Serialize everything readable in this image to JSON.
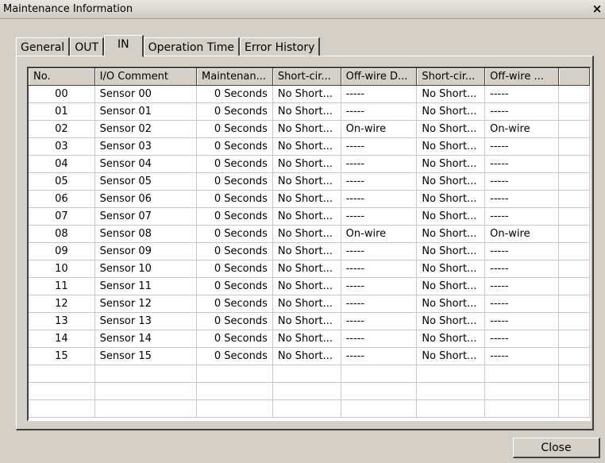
{
  "window": {
    "title": "Maintenance Information",
    "close_glyph": "×"
  },
  "tabs": [
    {
      "label": "General"
    },
    {
      "label": "OUT"
    },
    {
      "label": "IN",
      "active": true
    },
    {
      "label": "Operation Time"
    },
    {
      "label": "Error History"
    }
  ],
  "table": {
    "columns": [
      "No.",
      "I/O Comment",
      "Maintenan...",
      "Short-cir...",
      "Off-wire D...",
      "Short-cir...",
      "Off-wire ...",
      ""
    ],
    "rows": [
      [
        "00",
        "Sensor 00",
        "0 Seconds",
        "No Short...",
        "-----",
        "No Short...",
        "-----"
      ],
      [
        "01",
        "Sensor 01",
        "0 Seconds",
        "No Short...",
        "-----",
        "No Short...",
        "-----"
      ],
      [
        "02",
        "Sensor 02",
        "0 Seconds",
        "No Short...",
        "On-wire",
        "No Short...",
        "On-wire"
      ],
      [
        "03",
        "Sensor 03",
        "0 Seconds",
        "No Short...",
        "-----",
        "No Short...",
        "-----"
      ],
      [
        "04",
        "Sensor 04",
        "0 Seconds",
        "No Short...",
        "-----",
        "No Short...",
        "-----"
      ],
      [
        "05",
        "Sensor 05",
        "0 Seconds",
        "No Short...",
        "-----",
        "No Short...",
        "-----"
      ],
      [
        "06",
        "Sensor 06",
        "0 Seconds",
        "No Short...",
        "-----",
        "No Short...",
        "-----"
      ],
      [
        "07",
        "Sensor 07",
        "0 Seconds",
        "No Short...",
        "-----",
        "No Short...",
        "-----"
      ],
      [
        "08",
        "Sensor 08",
        "0 Seconds",
        "No Short...",
        "On-wire",
        "No Short...",
        "On-wire"
      ],
      [
        "09",
        "Sensor 09",
        "0 Seconds",
        "No Short...",
        "-----",
        "No Short...",
        "-----"
      ],
      [
        "10",
        "Sensor 10",
        "0 Seconds",
        "No Short...",
        "-----",
        "No Short...",
        "-----"
      ],
      [
        "11",
        "Sensor 11",
        "0 Seconds",
        "No Short...",
        "-----",
        "No Short...",
        "-----"
      ],
      [
        "12",
        "Sensor 12",
        "0 Seconds",
        "No Short...",
        "-----",
        "No Short...",
        "-----"
      ],
      [
        "13",
        "Sensor 13",
        "0 Seconds",
        "No Short...",
        "-----",
        "No Short...",
        "-----"
      ],
      [
        "14",
        "Sensor 14",
        "0 Seconds",
        "No Short...",
        "-----",
        "No Short...",
        "-----"
      ],
      [
        "15",
        "Sensor 15",
        "0 Seconds",
        "No Short...",
        "-----",
        "No Short...",
        "-----"
      ]
    ],
    "empty_rows": 3
  },
  "buttons": {
    "close": "Close"
  },
  "icons": {
    "close": "close-icon"
  }
}
